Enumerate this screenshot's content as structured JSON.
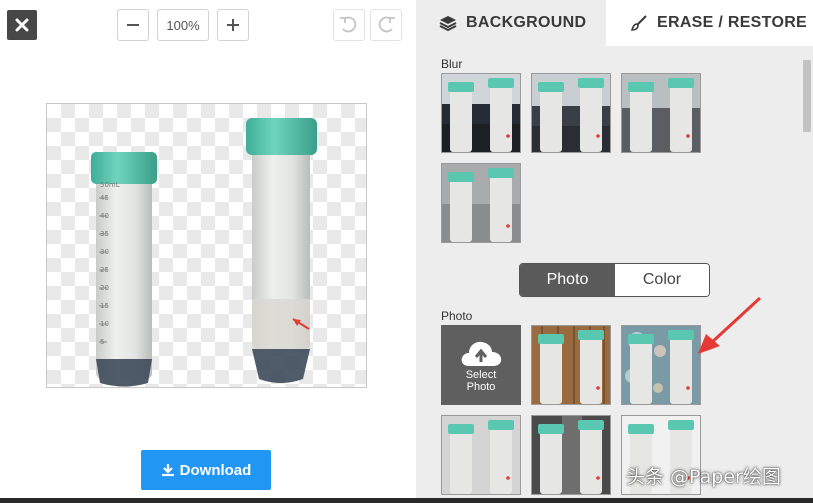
{
  "toolbar": {
    "zoom_value": "100%",
    "close_icon": "close-icon",
    "zoom_out_icon": "minus-icon",
    "zoom_in_icon": "plus-icon",
    "undo_icon": "undo-icon",
    "redo_icon": "redo-icon"
  },
  "download": {
    "label": "Download",
    "icon": "download-icon"
  },
  "tabs": {
    "background": {
      "label": "BACKGROUND",
      "icon": "layers-icon"
    },
    "erase": {
      "label": "ERASE / RESTORE",
      "icon": "brush-icon"
    }
  },
  "blur": {
    "label": "Blur",
    "thumbnail_count": 4
  },
  "segment": {
    "photo": "Photo",
    "color": "Color",
    "selected": "Photo"
  },
  "photo": {
    "label": "Photo",
    "select_photo": [
      "Select",
      "Photo"
    ],
    "select_icon": "cloud-upload-icon",
    "thumbnail_count": 7
  },
  "canvas": {
    "tube_small_labels": [
      "50mL",
      "45",
      "40",
      "35",
      "30",
      "25",
      "20",
      "15",
      "10",
      "5"
    ]
  },
  "colors": {
    "accent": "#2196f3",
    "cap": "#5ac8b0",
    "panel": "#ededed",
    "arrow": "#e53935"
  },
  "watermark": "头条 @Paper绘图"
}
